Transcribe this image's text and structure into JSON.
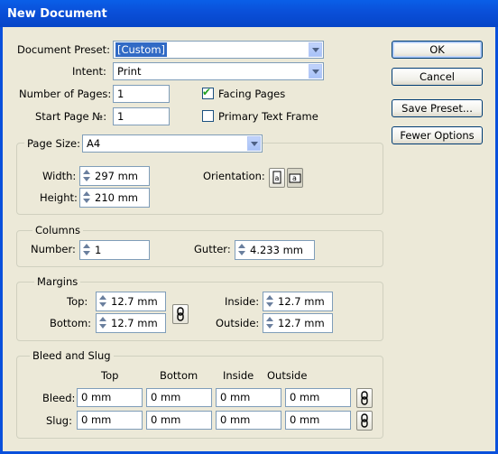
{
  "window": {
    "title": "New Document"
  },
  "buttons": {
    "ok": "OK",
    "cancel": "Cancel",
    "save_preset": "Save Preset...",
    "fewer_options": "Fewer Options"
  },
  "document_preset": {
    "label": "Document Preset:",
    "value": "[Custom]"
  },
  "intent": {
    "label": "Intent:",
    "value": "Print"
  },
  "number_of_pages": {
    "label": "Number of Pages:",
    "value": "1"
  },
  "start_page": {
    "label": "Start Page №:",
    "value": "1"
  },
  "facing_pages": {
    "label": "Facing Pages",
    "checked": true
  },
  "primary_text_frame": {
    "label": "Primary Text Frame",
    "checked": false
  },
  "page_size": {
    "label": "Page Size:",
    "value": "A4",
    "width_label": "Width:",
    "width": "297 mm",
    "height_label": "Height:",
    "height": "210 mm",
    "orientation_label": "Orientation:"
  },
  "columns": {
    "title": "Columns",
    "number_label": "Number:",
    "number": "1",
    "gutter_label": "Gutter:",
    "gutter": "4.233 mm"
  },
  "margins": {
    "title": "Margins",
    "top_label": "Top:",
    "top": "12.7 mm",
    "bottom_label": "Bottom:",
    "bottom": "12.7 mm",
    "inside_label": "Inside:",
    "inside": "12.7 mm",
    "outside_label": "Outside:",
    "outside": "12.7 mm"
  },
  "bleed_slug": {
    "title": "Bleed and Slug",
    "headers": {
      "top": "Top",
      "bottom": "Bottom",
      "inside": "Inside",
      "outside": "Outside"
    },
    "bleed_label": "Bleed:",
    "bleed": {
      "top": "0 mm",
      "bottom": "0 mm",
      "inside": "0 mm",
      "outside": "0 mm"
    },
    "slug_label": "Slug:",
    "slug": {
      "top": "0 mm",
      "bottom": "0 mm",
      "inside": "0 mm",
      "outside": "0 mm"
    }
  }
}
